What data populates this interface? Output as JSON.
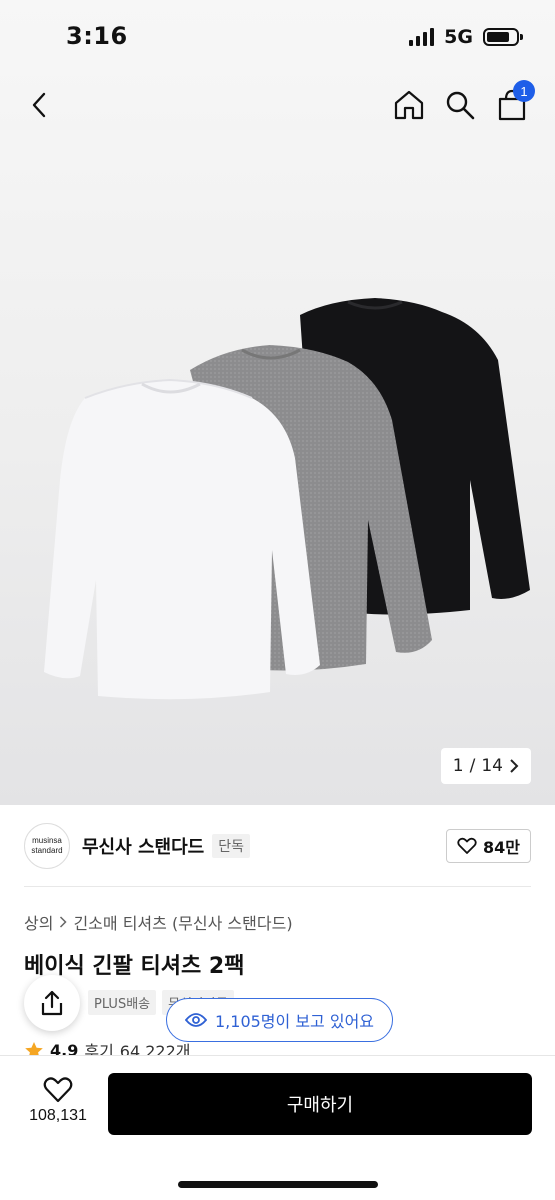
{
  "status_bar": {
    "time": "3:16",
    "network": "5G"
  },
  "nav": {
    "cart_count": "1"
  },
  "gallery": {
    "current": "1",
    "separator": "/",
    "total": "14"
  },
  "brand": {
    "logo_line1": "musinsa",
    "logo_line2": "standard",
    "name": "무신사 스탠다드",
    "exclusive_tag": "단독",
    "likes": "84만"
  },
  "breadcrumb": {
    "category": "상의",
    "subcategory": "긴소매 티셔츠 (무신사 스탠다드)"
  },
  "product": {
    "title": "베이식 긴팔 티셔츠 2팩"
  },
  "tags": [
    "PLUS배송",
    "무신사단독"
  ],
  "rating": {
    "score": "4.9",
    "review_label": "후기",
    "review_count": "64,222개"
  },
  "viewers": {
    "text": "1,105명이 보고 있어요"
  },
  "bottom_bar": {
    "wish_count": "108,131",
    "buy_label": "구매하기"
  },
  "colors": {
    "accent_blue": "#1e5ee8",
    "buy_button": "#000000",
    "star": "#f5a623"
  },
  "icons": [
    "back-icon",
    "home-icon",
    "search-icon",
    "cart-icon",
    "chevron-right-icon",
    "heart-icon",
    "share-icon",
    "eye-icon",
    "star-icon"
  ]
}
